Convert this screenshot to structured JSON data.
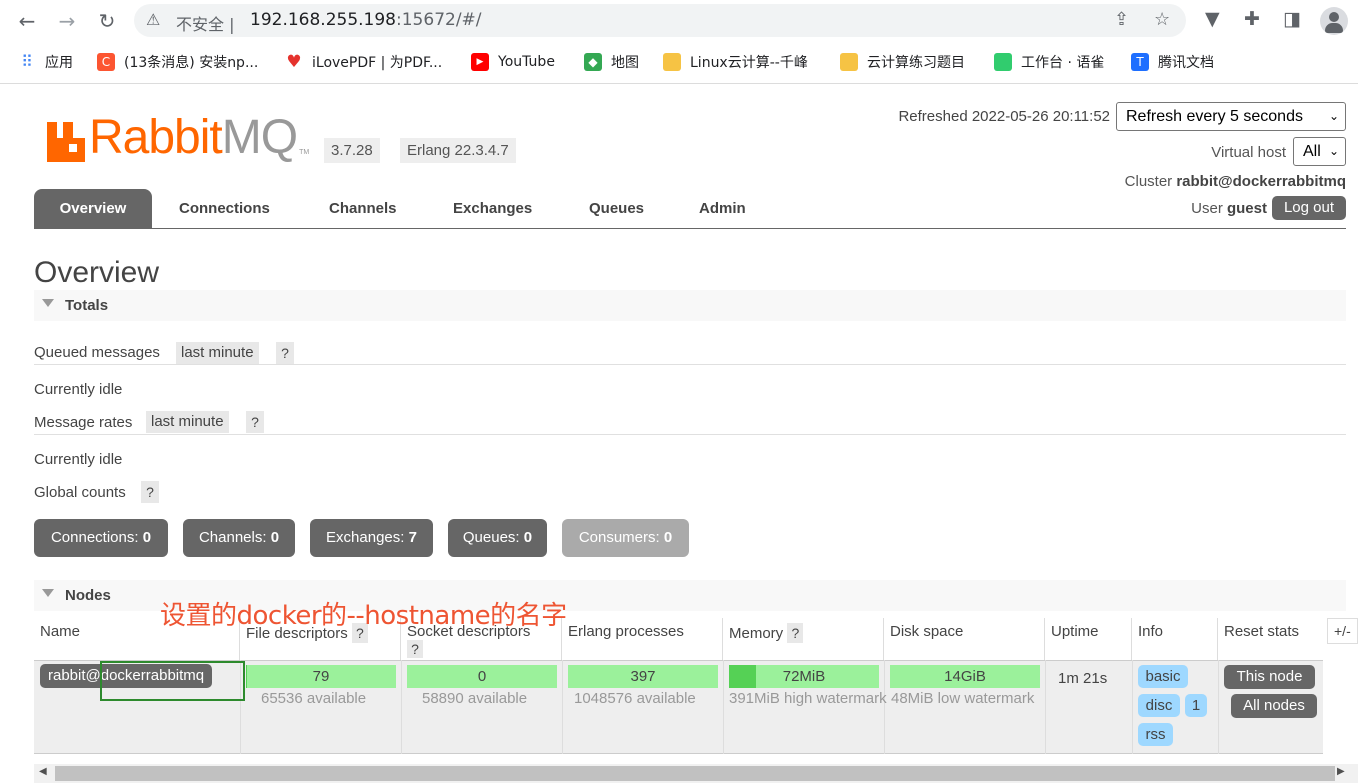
{
  "browser": {
    "insecure_label": "不安全",
    "url_host": "192.168.255.198",
    "url_rest": ":15672/#/",
    "bookmarks": [
      {
        "label": "应用",
        "color": "#4285f4"
      },
      {
        "label": "(13条消息) 安装np...",
        "color": "#fc5531"
      },
      {
        "label": "iLovePDF | 为PDF...",
        "color": "#e5322d"
      },
      {
        "label": "YouTube",
        "color": "#ff0000"
      },
      {
        "label": "地图",
        "color": "#34a853"
      },
      {
        "label": "Linux云计算--千峰",
        "color": "#f6c344"
      },
      {
        "label": "云计算练习题目",
        "color": "#f6c344"
      },
      {
        "label": "工作台 · 语雀",
        "color": "#31cc6e"
      },
      {
        "label": "腾讯文档",
        "color": "#1e6fff"
      }
    ]
  },
  "header": {
    "logo_rabbit": "Rabbit",
    "logo_mq": "MQ",
    "logo_tm": "TM",
    "version": "3.7.28",
    "erlang": "Erlang 22.3.4.7",
    "refreshed_label": "Refreshed 2022-05-26 20:11:52",
    "refresh_select": "Refresh every 5 seconds",
    "vhost_label": "Virtual host",
    "vhost_select": "All",
    "cluster_label": "Cluster",
    "cluster_name": "rabbit@dockerrabbitmq",
    "user_label": "User",
    "user_name": "guest",
    "logout_label": "Log out"
  },
  "tabs": [
    "Overview",
    "Connections",
    "Channels",
    "Exchanges",
    "Queues",
    "Admin"
  ],
  "page_title": "Overview",
  "totals": {
    "section_title": "Totals",
    "queued_label": "Queued messages",
    "queued_range": "last minute",
    "help": "?",
    "idle_1": "Currently idle",
    "rates_label": "Message rates",
    "rates_range": "last minute",
    "idle_2": "Currently idle",
    "global_label": "Global counts"
  },
  "counts": [
    {
      "label": "Connections:",
      "value": "0"
    },
    {
      "label": "Channels:",
      "value": "0"
    },
    {
      "label": "Exchanges:",
      "value": "7"
    },
    {
      "label": "Queues:",
      "value": "0"
    },
    {
      "label": "Consumers:",
      "value": "0"
    }
  ],
  "nodes": {
    "section_title": "Nodes",
    "annotation": "设置的docker的--hostname的名字",
    "columns": [
      "Name",
      "File descriptors",
      "Socket descriptors",
      "Erlang processes",
      "Memory",
      "Disk space",
      "Uptime",
      "Info",
      "Reset stats"
    ],
    "plusminus": "+/-",
    "row": {
      "name": "rabbit@dockerrabbitmq",
      "file_desc": "79",
      "file_desc_avail": "65536 available",
      "file_desc_fraction": 0.0012,
      "socket_desc": "0",
      "socket_desc_avail": "58890 available",
      "socket_desc_fraction": 0,
      "erlang_proc": "397",
      "erlang_proc_avail": "1048576 available",
      "erlang_proc_fraction": 0.0004,
      "memory": "72MiB",
      "memory_sub": "391MiB high watermark",
      "memory_fraction": 0.18,
      "disk": "14GiB",
      "disk_sub": "48MiB low watermark",
      "disk_fraction": 0,
      "uptime": "1m 21s",
      "info_tags": [
        "basic",
        "disc",
        "1",
        "rss"
      ],
      "reset_this": "This node",
      "reset_all": "All nodes"
    }
  }
}
